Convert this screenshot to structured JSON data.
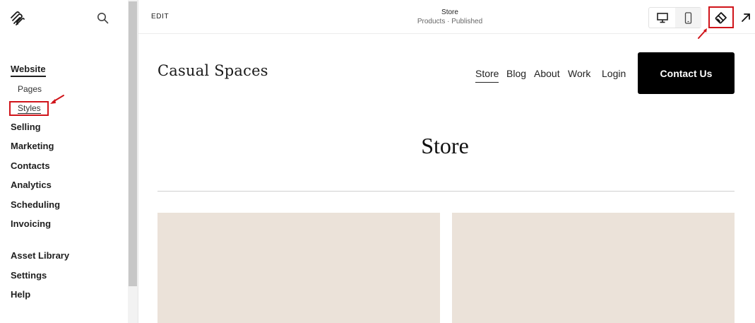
{
  "sidebar": {
    "items": [
      {
        "label": "Website",
        "active": true
      },
      {
        "label": "Selling"
      },
      {
        "label": "Marketing"
      },
      {
        "label": "Contacts"
      },
      {
        "label": "Analytics"
      },
      {
        "label": "Scheduling"
      },
      {
        "label": "Invoicing"
      },
      {
        "label": "Asset Library"
      },
      {
        "label": "Settings"
      },
      {
        "label": "Help"
      }
    ],
    "website_sub": [
      {
        "label": "Pages"
      },
      {
        "label": "Styles",
        "highlighted": true
      }
    ],
    "icons": {
      "logo": "squarespace-logo-icon",
      "search": "search-icon"
    }
  },
  "editor": {
    "edit_label": "EDIT",
    "page_title": "Store",
    "page_status": "Products · Published",
    "view_icons": [
      "desktop-icon",
      "mobile-icon"
    ],
    "style_icon": "paintbrush-icon",
    "expand_icon": "arrow-up-right-icon",
    "annotation_color": "#d0141a"
  },
  "site": {
    "title": "Casual Spaces",
    "nav": [
      "Store",
      "Blog",
      "About",
      "Work",
      "Login"
    ],
    "current_nav": "Store",
    "cta": "Contact Us",
    "heading": "Store",
    "product_placeholder_color": "#ebe2d9"
  }
}
